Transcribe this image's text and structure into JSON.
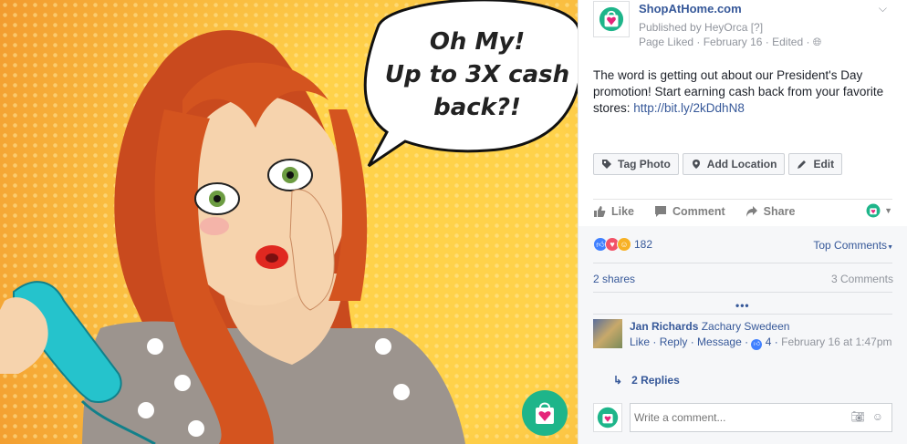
{
  "photo": {
    "speech_lines": [
      "Oh My!",
      "Up to 3X cash",
      "back?!"
    ]
  },
  "post": {
    "page_name": "ShopAtHome.com",
    "published_by": "Published by HeyOrca [?]",
    "meta_prefix": "Page Liked",
    "date": "February 16",
    "edited": "Edited",
    "text": "The word is getting out about our President's Day promotion! Start earning cash back from your favorite stores: ",
    "link": "http://bit.ly/2kDdhN8"
  },
  "photo_actions": {
    "tag_photo": "Tag Photo",
    "add_location": "Add Location",
    "edit": "Edit"
  },
  "ufi": {
    "like": "Like",
    "comment": "Comment",
    "share": "Share"
  },
  "feedback": {
    "reactions_count": "182",
    "top_comments": "Top Comments",
    "shares": "2 shares",
    "comments": "3 Comments",
    "more": "•••"
  },
  "comment": {
    "author": "Jan Richards",
    "mention": "Zachary Swedeen",
    "like": "Like",
    "reply": "Reply",
    "message": "Message",
    "likes": "4",
    "timestamp": "February 16 at 1:47pm",
    "replies": "2 Replies"
  },
  "composer": {
    "placeholder": "Write a comment..."
  },
  "colors": {
    "brand_green": "#1eb58a",
    "heart_pink": "#e5267a",
    "link_blue": "#365899"
  }
}
